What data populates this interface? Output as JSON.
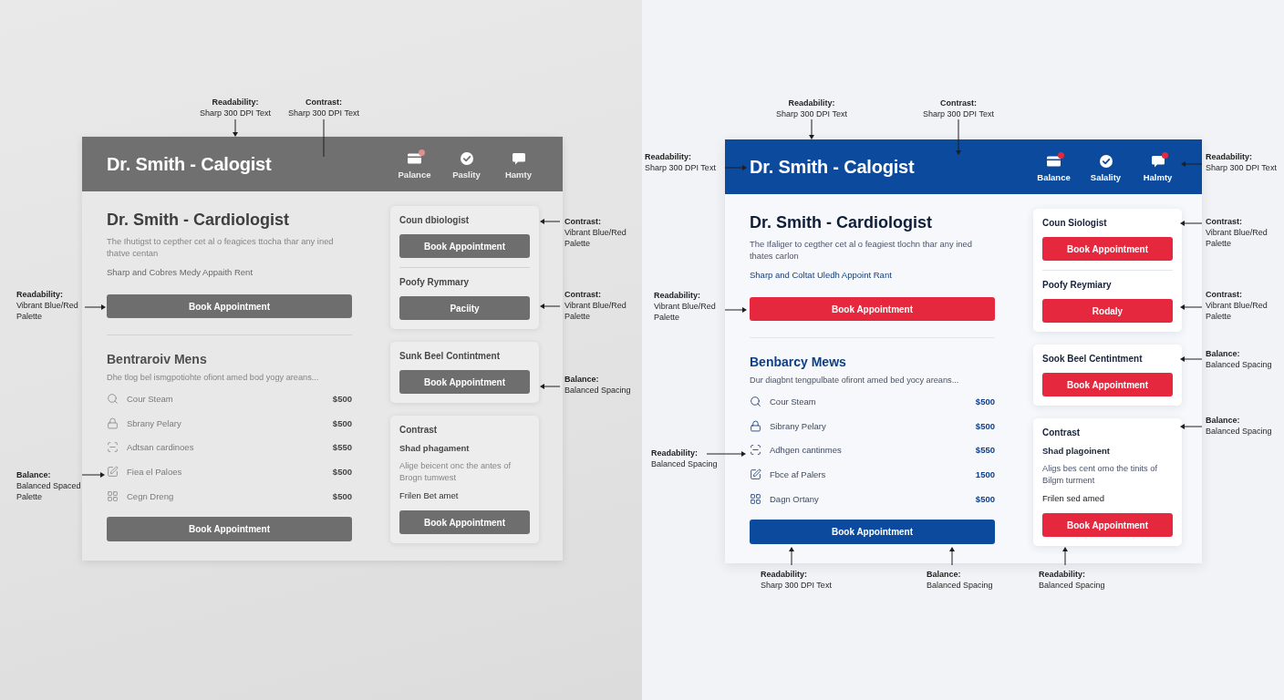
{
  "panels": [
    {
      "kind": "greyscale",
      "mockup": {
        "header": {
          "title": "Dr. Smith - Calogist",
          "nav": [
            {
              "label": "Palance",
              "badge": true
            },
            {
              "label": "Paslity",
              "badge": false
            },
            {
              "label": "Hamty",
              "badge": false
            }
          ]
        },
        "main": {
          "title": "Dr. Smith - Cardiologist",
          "intro": "The Ihutigst to cepther cet al o feagices ttocha thar any ined thatve centan",
          "tagline": "Sharp and Cobres Medy Appaith Rent",
          "primary_button": {
            "label": "Book Appointment",
            "color": "#6e6e6e"
          },
          "section_title": "Bentraroiv Mens",
          "section_text": "Dhe tlog bel ismgpotiohte ofiont amed bod yogy areans...",
          "services": [
            {
              "name": "Cour Steam",
              "price": "$500"
            },
            {
              "name": "Sbrany Pelary",
              "price": "$500"
            },
            {
              "name": "Adtsan cardinoes",
              "price": "$550"
            },
            {
              "name": "Fiea el Paloes",
              "price": "$500"
            },
            {
              "name": "Cegn Dreng",
              "price": "$500"
            }
          ],
          "section_button": {
            "label": "Book Appointment",
            "color": "#6e6e6e"
          }
        },
        "cards": [
          {
            "sections": [
              {
                "title": "Coun dbiologist",
                "button": {
                  "label": "Book Appointment",
                  "color": "#6e6e6e"
                }
              },
              {
                "title": "Poofy Rymmary",
                "button": {
                  "label": "Paciity",
                  "color": "#6e6e6e"
                }
              }
            ]
          },
          {
            "sections": [
              {
                "title": "Sunk Beel Contintment",
                "button": {
                  "label": "Book Appointment",
                  "color": "#6e6e6e"
                }
              }
            ]
          },
          {
            "sections": [
              {
                "title": "Contrast",
                "subtitle": "Shad phagament",
                "body": "Alige beicent onc the antes of Brogn tumwest",
                "note": "Frilen Bet amet",
                "button": {
                  "label": "Book Appointment",
                  "color": "#6e6e6e"
                }
              }
            ]
          }
        ]
      },
      "annotations": [
        {
          "heading": "Readability:",
          "lines": [
            "Sharp 300 DPI Text"
          ]
        },
        {
          "heading": "Contrast:",
          "lines": [
            "Sharp 300 DPI Text"
          ]
        },
        {
          "heading": "Contrast:",
          "lines": [
            "Vibrant Blue/Red",
            "Palette"
          ]
        },
        {
          "heading": "Readability:",
          "lines": [
            "Vibrant Blue/Red",
            "Palette"
          ]
        },
        {
          "heading": "Contrast:",
          "lines": [
            "Vibrant Blue/Red",
            "Palette"
          ]
        },
        {
          "heading": "Balance:",
          "lines": [
            "Balanced Spacing"
          ]
        },
        {
          "heading": "Balance:",
          "lines": [
            "Balanced Spaced",
            "Palette"
          ]
        }
      ]
    },
    {
      "kind": "color",
      "mockup": {
        "header": {
          "title": "Dr. Smith - Calogist",
          "nav": [
            {
              "label": "Balance",
              "badge": true
            },
            {
              "label": "Salality",
              "badge": false
            },
            {
              "label": "Halmty",
              "badge": true
            }
          ]
        },
        "main": {
          "title": "Dr. Smith - Cardiologist",
          "intro": "The Ifaliger to cegther cet al o feagiest tlochn thar any ined thates carlon",
          "tagline": "Sharp and Coltat Uledh Appoint Rant",
          "primary_button": {
            "label": "Book Appointment",
            "color": "#e5283e"
          },
          "section_title": "Benbarcy Mews",
          "section_text": "Dur diagbnt tengpulbate ofiront amed bed yocy areans...",
          "services": [
            {
              "name": "Cour Steam",
              "price": "$500"
            },
            {
              "name": "Sibrany Pelary",
              "price": "$500"
            },
            {
              "name": "Adhgen cantinmes",
              "price": "$550"
            },
            {
              "name": "Fbce af Palers",
              "price": "1500"
            },
            {
              "name": "Dagn Ortany",
              "price": "$500"
            }
          ],
          "section_button": {
            "label": "Book Appointment",
            "color": "#0b4a9c"
          }
        },
        "cards": [
          {
            "sections": [
              {
                "title": "Coun Siologist",
                "button": {
                  "label": "Book Appointment",
                  "color": "#e5283e"
                }
              },
              {
                "title": "Poofy Reymiary",
                "button": {
                  "label": "Rodaly",
                  "color": "#e5283e"
                }
              }
            ]
          },
          {
            "sections": [
              {
                "title": "Sook Beel Centintment",
                "button": {
                  "label": "Book Appointment",
                  "color": "#e5283e"
                }
              }
            ]
          },
          {
            "sections": [
              {
                "title": "Contrast",
                "subtitle": "Shad plagoinent",
                "body": "Aligs bes cent omo the tinits of Bilgm turment",
                "note": "Frilen sed amed",
                "button": {
                  "label": "Book Appointment",
                  "color": "#e5283e"
                }
              }
            ]
          }
        ]
      },
      "annotations": [
        {
          "heading": "Readability:",
          "lines": [
            "Sharp 300 DPI Text"
          ]
        },
        {
          "heading": "Contrast:",
          "lines": [
            "Sharp 300 DPI Text"
          ]
        },
        {
          "heading": "Readability:",
          "lines": [
            "Sharp 300 DPI Text"
          ]
        },
        {
          "heading": "Readability:",
          "lines": [
            "Sharp 300 DPI Text"
          ]
        },
        {
          "heading": "Contrast:",
          "lines": [
            "Vibrant Blue/Red",
            "Palette"
          ]
        },
        {
          "heading": "Readability:",
          "lines": [
            "Vibrant Blue/Red",
            "Palette"
          ]
        },
        {
          "heading": "Contrast:",
          "lines": [
            "Vibrant Blue/Red",
            "Palette"
          ]
        },
        {
          "heading": "Balance:",
          "lines": [
            "Balanced Spacing"
          ]
        },
        {
          "heading": "Balance:",
          "lines": [
            "Balanced Spacing"
          ]
        },
        {
          "heading": "Readability:",
          "lines": [
            "Balanced Spacing"
          ]
        },
        {
          "heading": "Readability:",
          "lines": [
            "Sharp 300 DPI Text"
          ]
        },
        {
          "heading": "Balance:",
          "lines": [
            "Balanced Spacing"
          ]
        },
        {
          "heading": "Readability:",
          "lines": [
            "Balanced Spacing"
          ]
        }
      ]
    }
  ]
}
